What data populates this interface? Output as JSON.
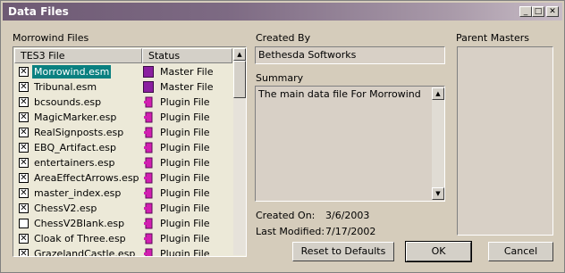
{
  "window": {
    "title": "Data Files"
  },
  "files_panel": {
    "label": "Morrowind Files",
    "col_file": "TES3 File",
    "col_status": "Status",
    "rows": [
      {
        "checked": true,
        "name": "Morrowind.esm",
        "status": "Master File",
        "selected": true
      },
      {
        "checked": true,
        "name": "Tribunal.esm",
        "status": "Master File",
        "selected": false
      },
      {
        "checked": true,
        "name": "bcsounds.esp",
        "status": "Plugin File",
        "selected": false
      },
      {
        "checked": true,
        "name": "MagicMarker.esp",
        "status": "Plugin File",
        "selected": false
      },
      {
        "checked": true,
        "name": "RealSignposts.esp",
        "status": "Plugin File",
        "selected": false
      },
      {
        "checked": true,
        "name": "EBQ_Artifact.esp",
        "status": "Plugin File",
        "selected": false
      },
      {
        "checked": true,
        "name": "entertainers.esp",
        "status": "Plugin File",
        "selected": false
      },
      {
        "checked": true,
        "name": "AreaEffectArrows.esp",
        "status": "Plugin File",
        "selected": false
      },
      {
        "checked": true,
        "name": "master_index.esp",
        "status": "Plugin File",
        "selected": false
      },
      {
        "checked": true,
        "name": "ChessV2.esp",
        "status": "Plugin File",
        "selected": false
      },
      {
        "checked": false,
        "name": "ChessV2Blank.esp",
        "status": "Plugin File",
        "selected": false
      },
      {
        "checked": true,
        "name": "Cloak of Three.esp",
        "status": "Plugin File",
        "selected": false
      },
      {
        "checked": true,
        "name": "GrazelandCastle.esp",
        "status": "Plugin File",
        "selected": false
      }
    ]
  },
  "created_by": {
    "label": "Created By",
    "value": "Bethesda Softworks"
  },
  "summary": {
    "label": "Summary",
    "value": "The main data file For Morrowind"
  },
  "parent_masters": {
    "label": "Parent Masters"
  },
  "created_on": {
    "label": "Created On:",
    "value": "3/6/2003"
  },
  "last_modified": {
    "label": "Last Modified:",
    "value": "7/17/2002"
  },
  "buttons": {
    "reset": "Reset to Defaults",
    "ok": "OK",
    "cancel": "Cancel"
  },
  "colors": {
    "selection": "#0a8080",
    "master_icon": "#8a1fa0",
    "plugin_icon": "#d11fb0",
    "title_bar": "#6e5a74"
  }
}
